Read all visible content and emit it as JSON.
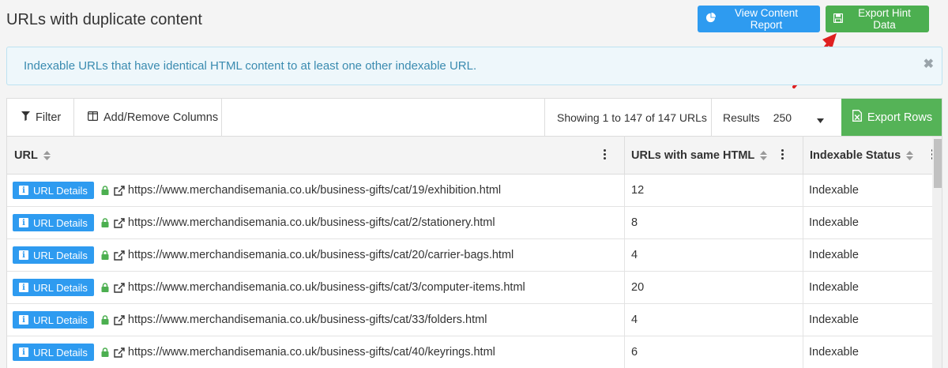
{
  "page": {
    "title": "URLs with duplicate content"
  },
  "header_buttons": {
    "view_report": "View Content Report",
    "export_hint": "Export Hint Data"
  },
  "info": {
    "text": "Indexable URLs that have identical HTML content to at least one other indexable URL.",
    "close_glyph": "✖"
  },
  "toolbar": {
    "filter": "Filter",
    "columns": "Add/Remove Columns",
    "showing": "Showing 1 to 147 of 147 URLs",
    "results_label": "Results",
    "results_value": "250",
    "export_rows": "Export Rows"
  },
  "table": {
    "columns": [
      "URL",
      "URLs with same HTML",
      "Indexable Status"
    ],
    "row_button": "URL Details",
    "rows": [
      {
        "url": "https://www.merchandisemania.co.uk/business-gifts/cat/19/exhibition.html",
        "same": "12",
        "status": "Indexable"
      },
      {
        "url": "https://www.merchandisemania.co.uk/business-gifts/cat/2/stationery.html",
        "same": "8",
        "status": "Indexable"
      },
      {
        "url": "https://www.merchandisemania.co.uk/business-gifts/cat/20/carrier-bags.html",
        "same": "4",
        "status": "Indexable"
      },
      {
        "url": "https://www.merchandisemania.co.uk/business-gifts/cat/3/computer-items.html",
        "same": "20",
        "status": "Indexable"
      },
      {
        "url": "https://www.merchandisemania.co.uk/business-gifts/cat/33/folders.html",
        "same": "4",
        "status": "Indexable"
      },
      {
        "url": "https://www.merchandisemania.co.uk/business-gifts/cat/40/keyrings.html",
        "same": "6",
        "status": "Indexable"
      }
    ]
  },
  "colors": {
    "primary_blue": "#2e9bf0",
    "export_green": "#4caf50",
    "lock_green": "#4caf50",
    "annotation_arrow": "#e02020"
  },
  "icons": [
    "pie-chart-icon",
    "save-icon",
    "filter-icon",
    "columns-icon",
    "caret-down-icon",
    "excel-icon",
    "sort-icon",
    "kebab-icon",
    "info-icon",
    "lock-icon",
    "external-link-icon",
    "close-icon"
  ]
}
